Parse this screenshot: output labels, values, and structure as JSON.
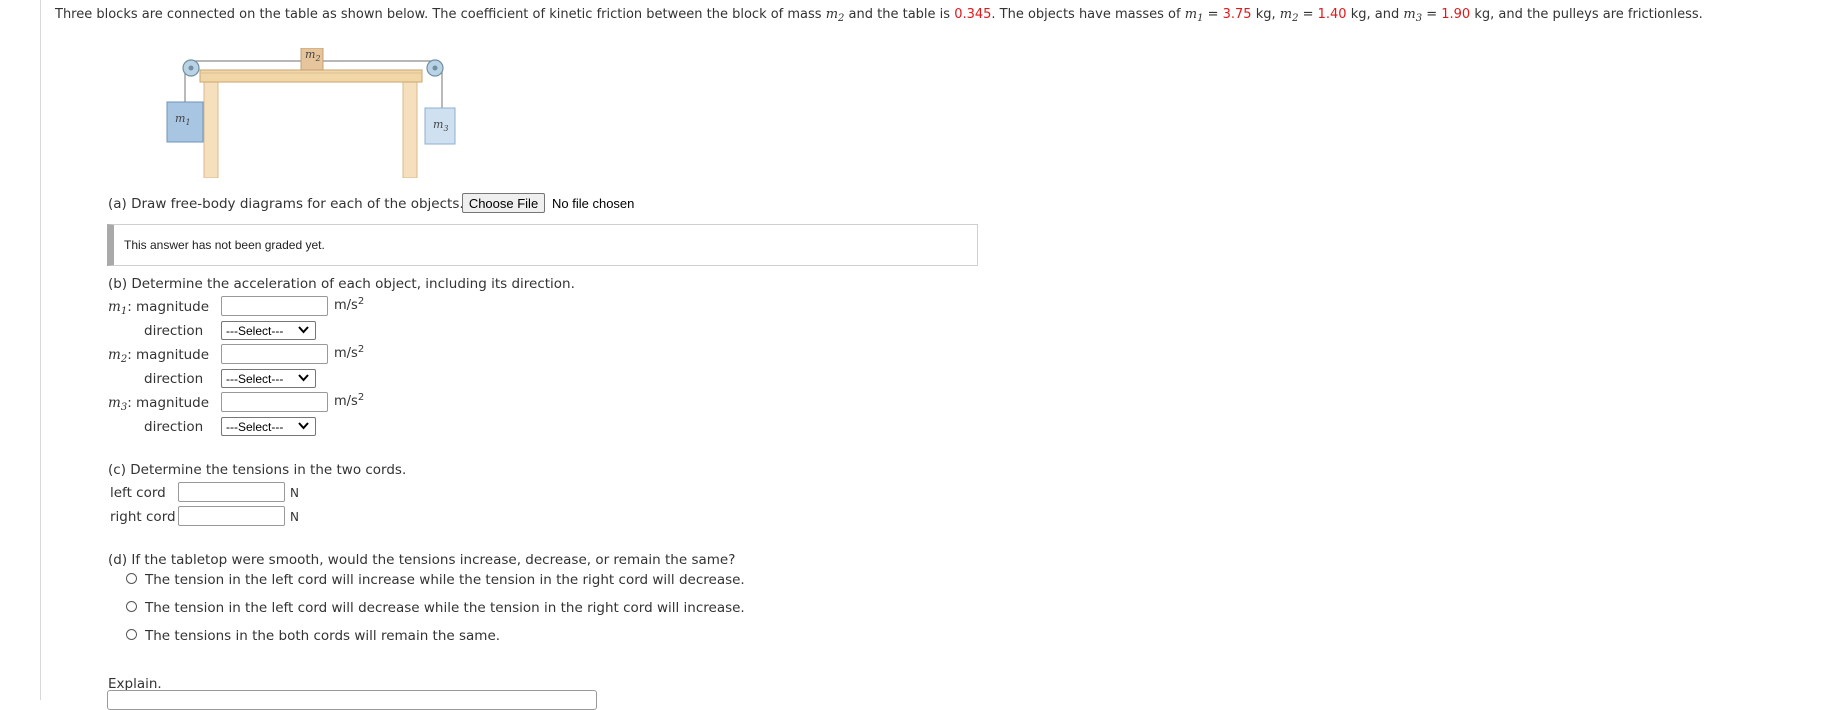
{
  "problem": {
    "intro_a": "Three blocks are connected on the table as shown below. The coefficient of kinetic friction between the block of mass",
    "m2_var": "m",
    "m2_sub": "2",
    "intro_b": "and the table is",
    "mu": "0.345",
    "intro_c": ". The objects have masses of",
    "m1_sub": "1",
    "m1_value": "3.75",
    "m2_value": "1.40",
    "m3_sub": "3",
    "m3_value": "1.90",
    "unit_kg": "kg",
    "and_word": "and",
    "outro": ", and the pulleys are frictionless.",
    "accent_color": "#e0191b"
  },
  "figure": {
    "label_m1": "m",
    "sub_m1": "1",
    "label_m2": "m",
    "sub_m2": "2",
    "label_m3": "m",
    "sub_m3": "3"
  },
  "part_a": {
    "prompt": "(a) Draw free-body diagrams for each of the objects.",
    "choose_file_label": "Choose File",
    "no_file_text": "No file chosen",
    "graded_text": "This answer has not been graded yet."
  },
  "part_b": {
    "prompt": "(b) Determine the acceleration of each object, including its direction.",
    "rows": [
      {
        "var": "m",
        "sub": "1",
        "magnitude_label": ": magnitude",
        "magnitude_value": "",
        "unit": "m/s",
        "unit_sup": "2",
        "direction_label": "direction",
        "direction_selected": "---Select---"
      },
      {
        "var": "m",
        "sub": "2",
        "magnitude_label": ": magnitude",
        "magnitude_value": "",
        "unit": "m/s",
        "unit_sup": "2",
        "direction_label": "direction",
        "direction_selected": "---Select---"
      },
      {
        "var": "m",
        "sub": "3",
        "magnitude_label": ": magnitude",
        "magnitude_value": "",
        "unit": "m/s",
        "unit_sup": "2",
        "direction_label": "direction",
        "direction_selected": "---Select---"
      }
    ]
  },
  "part_c": {
    "prompt": "(c) Determine the tensions in the two cords.",
    "left_label": "left cord",
    "left_value": "",
    "right_label": "right cord",
    "right_value": "",
    "unit": "N"
  },
  "part_d": {
    "prompt": "(d) If the tabletop were smooth, would the tensions increase, decrease, or remain the same?",
    "options": [
      "The tension in the left cord will increase while the tension in the right cord will decrease.",
      "The tension in the left cord will decrease while the tension in the right cord will increase.",
      "The tensions in the both cords will remain the same."
    ],
    "explain_label": "Explain."
  }
}
